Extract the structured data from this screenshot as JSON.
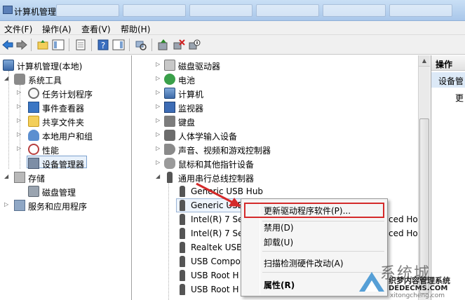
{
  "window": {
    "title": "计算机管理"
  },
  "menu": {
    "items": [
      "文件(F)",
      "操作(A)",
      "查看(V)",
      "帮助(H)"
    ]
  },
  "left_tree": {
    "root": "计算机管理(本地)",
    "system_tools": "系统工具",
    "task_scheduler": "任务计划程序",
    "event_viewer": "事件查看器",
    "shared_folders": "共享文件夹",
    "local_users": "本地用户和组",
    "performance": "性能",
    "device_manager": "设备管理器",
    "storage": "存储",
    "disk_management": "磁盘管理",
    "services_apps": "服务和应用程序"
  },
  "device_tree": {
    "categories": [
      "磁盘驱动器",
      "电池",
      "计算机",
      "监视器",
      "键盘",
      "人体学输入设备",
      "声音、视频和游戏控制器",
      "鼠标和其他指针设备",
      "通用串行总线控制器"
    ],
    "usb_devices": [
      "Generic USB Hub",
      "Generic USB",
      "Intel(R) 7 Se",
      "Intel(R) 7 Se",
      "Realtek USB",
      "USB Compo",
      "USB Root H",
      "USB Root H"
    ],
    "partial_right": [
      "ced Ho",
      "ced Ho"
    ]
  },
  "context_menu": {
    "update_driver": "更新驱动程序软件(P)...",
    "disable": "禁用(D)",
    "uninstall": "卸载(U)",
    "scan": "扫描检测硬件改动(A)",
    "properties": "属性(R)"
  },
  "actions_pane": {
    "header": "操作",
    "subheader": "设备管",
    "more": "更"
  },
  "watermark": {
    "brand": "系统城",
    "line1": "织梦内容管理系统",
    "line2": "DEDECMS.COM",
    "line3": "xitongcheng.com"
  },
  "colors": {
    "highlight_border": "#d42a2a",
    "arrow": "#d42a2a"
  }
}
